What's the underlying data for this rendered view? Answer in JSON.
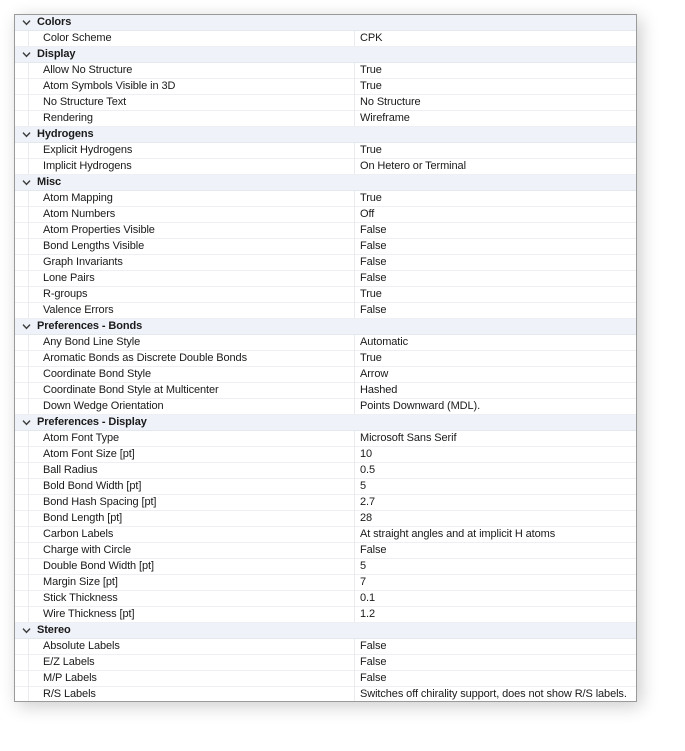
{
  "panel": {
    "name": "property-grid",
    "expand_icon": "chevron-down-icon",
    "colors": {
      "group_header_bg": "#eff3f9",
      "row_bg": "#ffffff",
      "border": "#9a9a9a",
      "row_separator": "#edeff2",
      "text": "#1a1a1a"
    }
  },
  "groups": [
    {
      "title": "Colors",
      "expanded": true,
      "rows": [
        {
          "name": "Color Scheme",
          "value": "CPK"
        }
      ]
    },
    {
      "title": "Display",
      "expanded": true,
      "rows": [
        {
          "name": "Allow No Structure",
          "value": "True"
        },
        {
          "name": "Atom Symbols Visible in 3D",
          "value": "True"
        },
        {
          "name": "No Structure Text",
          "value": "No Structure"
        },
        {
          "name": "Rendering",
          "value": "Wireframe"
        }
      ]
    },
    {
      "title": "Hydrogens",
      "expanded": true,
      "rows": [
        {
          "name": "Explicit Hydrogens",
          "value": "True"
        },
        {
          "name": "Implicit Hydrogens",
          "value": "On Hetero or Terminal"
        }
      ]
    },
    {
      "title": "Misc",
      "expanded": true,
      "rows": [
        {
          "name": "Atom Mapping",
          "value": "True"
        },
        {
          "name": "Atom Numbers",
          "value": "Off"
        },
        {
          "name": "Atom Properties Visible",
          "value": "False"
        },
        {
          "name": "Bond Lengths Visible",
          "value": "False"
        },
        {
          "name": "Graph Invariants",
          "value": "False"
        },
        {
          "name": "Lone Pairs",
          "value": "False"
        },
        {
          "name": "R-groups",
          "value": "True"
        },
        {
          "name": "Valence Errors",
          "value": "False"
        }
      ]
    },
    {
      "title": "Preferences - Bonds",
      "expanded": true,
      "rows": [
        {
          "name": "Any Bond Line Style",
          "value": "Automatic"
        },
        {
          "name": "Aromatic Bonds as Discrete Double Bonds",
          "value": "True"
        },
        {
          "name": "Coordinate Bond Style",
          "value": "Arrow"
        },
        {
          "name": "Coordinate Bond Style at Multicenter",
          "value": "Hashed"
        },
        {
          "name": "Down Wedge Orientation",
          "value": "Points Downward (MDL)."
        }
      ]
    },
    {
      "title": "Preferences - Display",
      "expanded": true,
      "rows": [
        {
          "name": "Atom Font Type",
          "value": "Microsoft Sans Serif"
        },
        {
          "name": "Atom Font Size [pt]",
          "value": "10"
        },
        {
          "name": "Ball Radius",
          "value": "0.5"
        },
        {
          "name": "Bold Bond Width [pt]",
          "value": "5"
        },
        {
          "name": "Bond Hash Spacing [pt]",
          "value": "2.7"
        },
        {
          "name": "Bond Length [pt]",
          "value": "28"
        },
        {
          "name": "Carbon Labels",
          "value": "At straight angles and at implicit H atoms"
        },
        {
          "name": "Charge with Circle",
          "value": "False"
        },
        {
          "name": "Double Bond Width [pt]",
          "value": "5"
        },
        {
          "name": "Margin Size [pt]",
          "value": "7"
        },
        {
          "name": "Stick Thickness",
          "value": "0.1"
        },
        {
          "name": "Wire Thickness [pt]",
          "value": "1.2"
        }
      ]
    },
    {
      "title": "Stereo",
      "expanded": true,
      "rows": [
        {
          "name": "Absolute Labels",
          "value": "False"
        },
        {
          "name": "E/Z Labels",
          "value": "False"
        },
        {
          "name": "M/P Labels",
          "value": "False"
        },
        {
          "name": "R/S Labels",
          "value": "Switches off chirality support, does not show R/S labels."
        }
      ]
    }
  ]
}
